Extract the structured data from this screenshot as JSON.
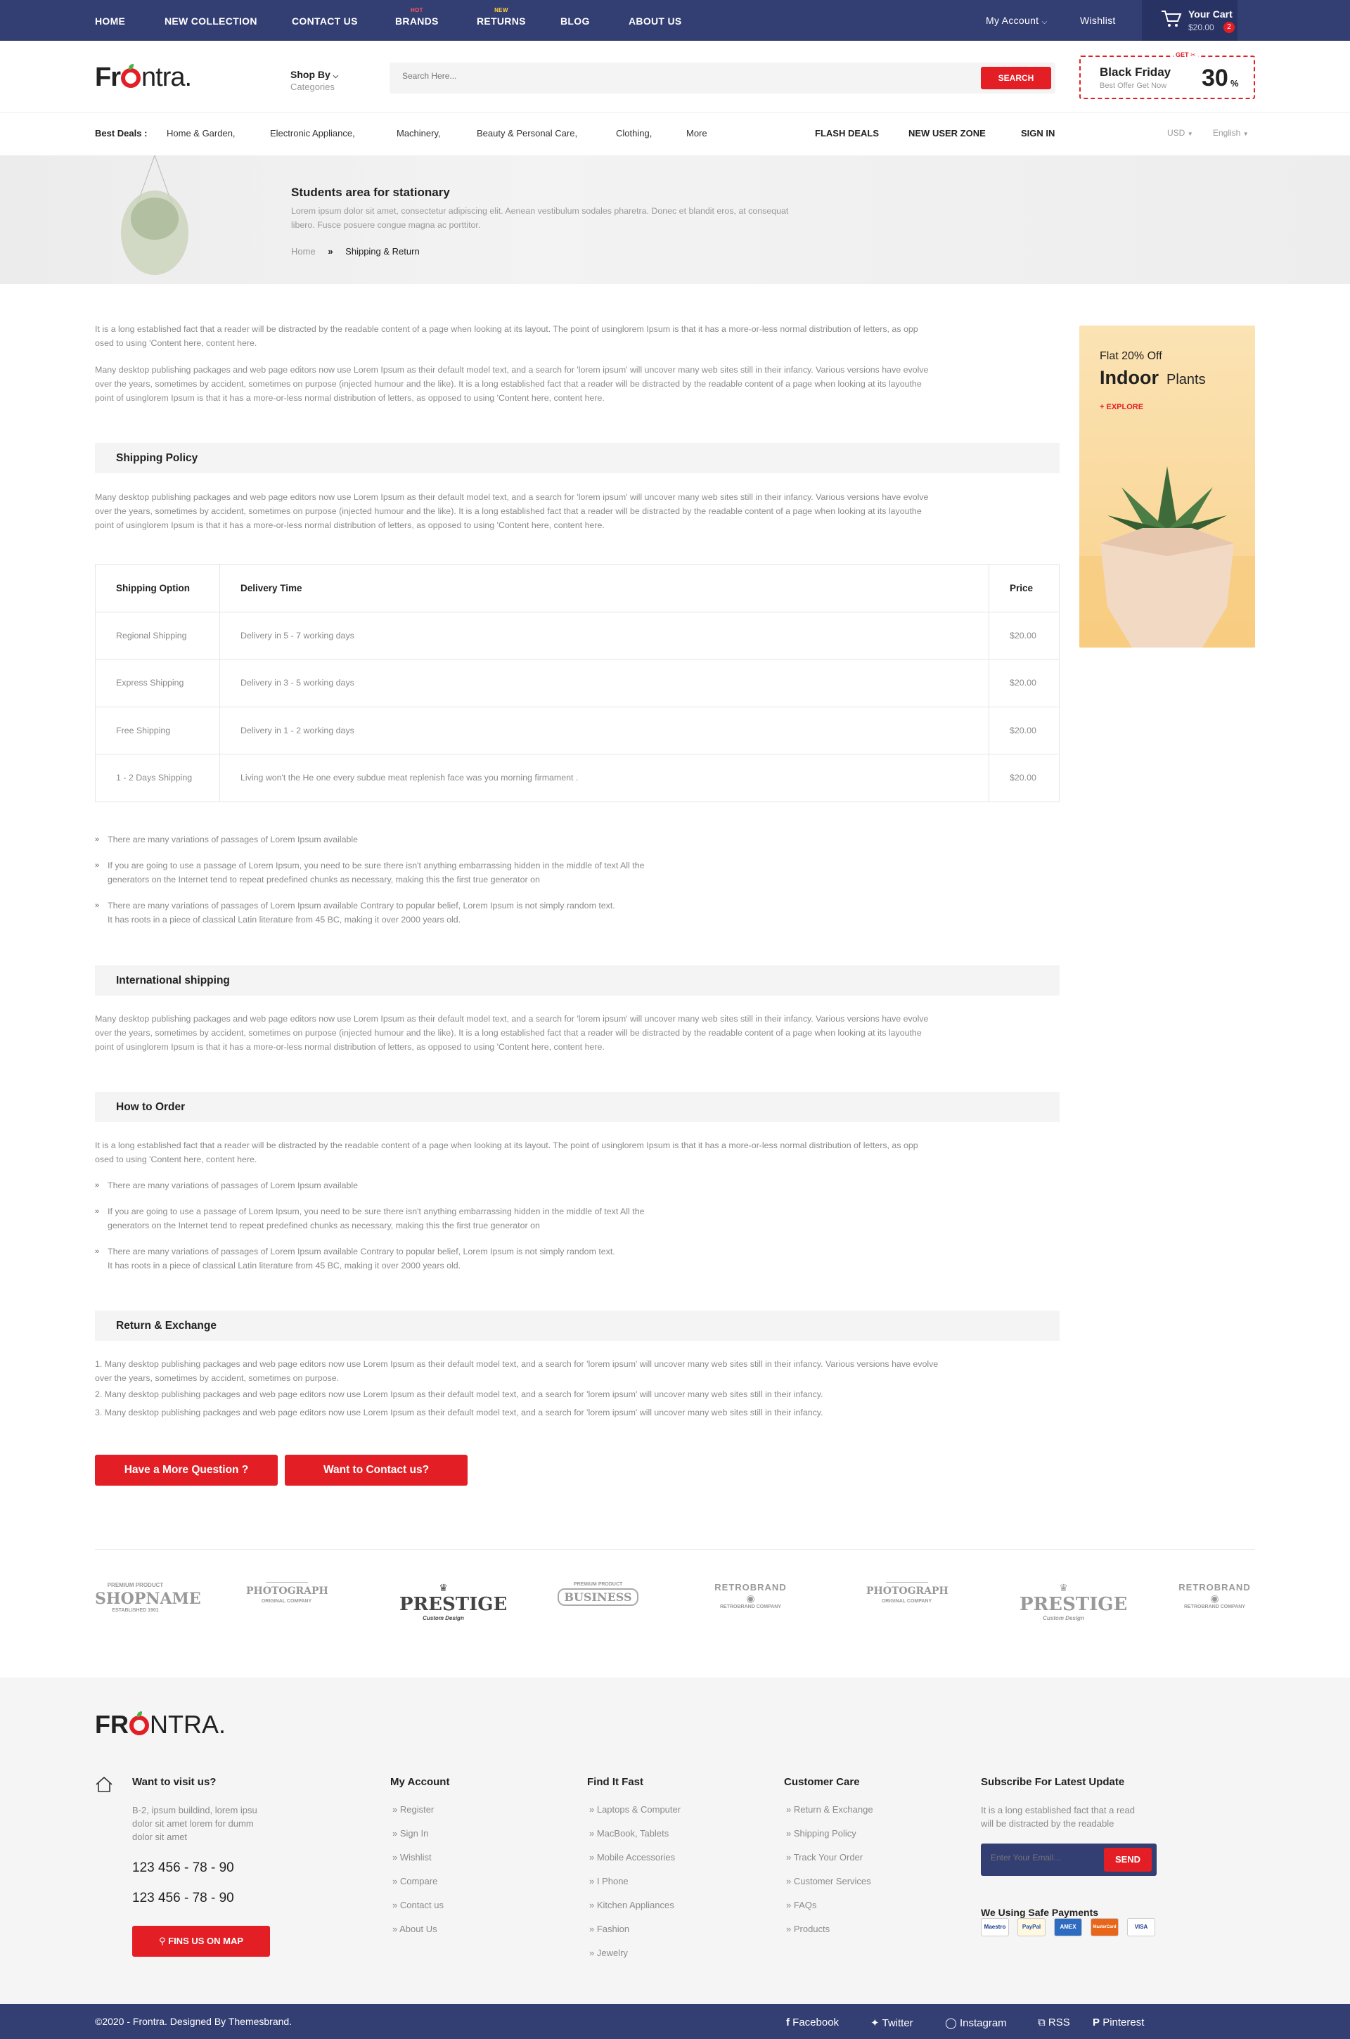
{
  "topbar": {
    "nav": [
      "HOME",
      "NEW COLLECTION",
      "CONTACT US",
      "BRANDS",
      "RETURNS",
      "BLOG",
      "ABOUT US"
    ],
    "brands_badge": "HOT",
    "returns_badge": "NEW",
    "my_account": "My Account",
    "wishlist": "Wishlist",
    "cart_title": "Your Cart",
    "cart_total": "$20.00",
    "cart_count": "2"
  },
  "header": {
    "logo_left": "Fr",
    "logo_right": "ntra.",
    "shop_by": "Shop By",
    "categories": "Categories",
    "search_placeholder": "Search Here...",
    "search_button": "SEARCH",
    "promo_get": "GET",
    "promo_title": "Black Friday",
    "promo_sub": "Best Offer Get Now",
    "promo_value": "30",
    "promo_unit": "%"
  },
  "deals": {
    "label": "Best Deals :",
    "items": [
      "Home & Garden,",
      "Electronic Appliance,",
      "Machinery,",
      "Beauty & Personal Care,",
      "Clothing,",
      "More"
    ],
    "links": [
      "FLASH DEALS",
      "NEW USER ZONE",
      "SIGN IN"
    ],
    "currency": "USD",
    "language": "English"
  },
  "banner": {
    "title": "Students area for stationary",
    "text1": "Lorem ipsum dolor sit amet, consectetur adipiscing elit. Aenean vestibulum sodales pharetra. Donec et blandit eros, at consequat",
    "text2": "libero. Fusce posuere congue magna ac porttitor.",
    "crumb_home": "Home",
    "crumb_sep": "»",
    "crumb_current": "Shipping & Return"
  },
  "intro": {
    "p1a": "It is a long established fact that a reader will be distracted by the readable content of a page when looking at its layout. The point of usinglorem Ipsum is that it has a more-or-less normal distribution of letters, as opp",
    "p1b": "osed to using 'Content here, content here.",
    "p2a": "Many desktop publishing packages and web page editors now use Lorem Ipsum as their default model text, and a search for 'lorem ipsum' will uncover many web sites still in their infancy. Various versions have evolve",
    "p2b": "over the years, sometimes by accident, sometimes on purpose (injected humour and the like). It is a long established fact that a reader will be distracted by the readable content of a page when looking at its layouthe",
    "p2c": "point of usinglorem Ipsum is that it has a more-or-less normal distribution of letters, as opposed to using 'Content here, content here."
  },
  "side_ad": {
    "line1": "Flat 20% Off",
    "big": "Indoor",
    "small": "Plants",
    "cta": "+ EXPLORE"
  },
  "shipping_policy": {
    "title": "Shipping Policy",
    "p_a": "Many desktop publishing packages and web page editors now use Lorem Ipsum as their default model text, and a search for 'lorem ipsum' will uncover many web sites still in their infancy. Various versions have evolve",
    "p_b": "over the years, sometimes by accident, sometimes on purpose (injected humour and the like). It is a long established fact that a reader will be distracted by the readable content of a page when looking at its layouthe",
    "p_c": "point of usinglorem Ipsum is that it has a more-or-less normal distribution of letters, as opposed to using 'Content here, content here."
  },
  "table": {
    "headers": [
      "Shipping Option",
      "Delivery Time",
      "Price"
    ],
    "rows": [
      [
        "Regional Shipping",
        "Delivery in 5 - 7 working days",
        "$20.00"
      ],
      [
        "Express Shipping",
        "Delivery in 3 - 5 working days",
        "$20.00"
      ],
      [
        "Free Shipping",
        "Delivery in 1 - 2 working days",
        "$20.00"
      ],
      [
        "1 - 2 Days Shipping",
        "Living won't the He one every subdue meat replenish face was you morning firmament .",
        "$20.00"
      ]
    ]
  },
  "bullets1": {
    "arrow": "»",
    "b1": "There are many variations of passages of Lorem Ipsum available",
    "b2a": " If you are going to use a passage of Lorem Ipsum, you need to be sure there isn't anything embarrassing hidden in the middle of text All the",
    "b2b": "generators on the Internet tend to repeat predefined chunks as necessary, making this the first true generator on",
    "b3a": "There are many variations of passages of Lorem Ipsum available Contrary to popular belief, Lorem Ipsum is not simply random text.",
    "b3b": "It has roots in a piece of classical Latin literature from 45 BC, making it over 2000 years old."
  },
  "international": {
    "title": "International shipping",
    "p_a": "Many desktop publishing packages and web page editors now use Lorem Ipsum as their default model text, and a search for 'lorem ipsum' will uncover many web sites still in their infancy. Various versions have evolve",
    "p_b": "over the years, sometimes by accident, sometimes on purpose (injected humour and the like). It is a long established fact that a reader will be distracted by the readable content of a page when looking at its layouthe",
    "p_c": "point of usinglorem Ipsum is that it has a more-or-less normal distribution of letters, as opposed to using 'Content here, content here."
  },
  "how_to_order": {
    "title": "How to Order",
    "p_a": "It is a long established fact that a reader will be distracted by the readable content of a page when looking at its layout. The point of usinglorem Ipsum is that it has a more-or-less normal distribution of letters, as opp",
    "p_b": "osed to using 'Content here, content here.",
    "b1": "There are many variations of passages of Lorem Ipsum available",
    "b2a": " If you are going to use a passage of Lorem Ipsum, you need to be sure there isn't anything embarrassing hidden in the middle of text All the",
    "b2b": "generators on the Internet tend to repeat predefined chunks as necessary, making this the first true generator on",
    "b3a": "There are many variations of passages of Lorem Ipsum available Contrary to popular belief, Lorem Ipsum is not simply random text.",
    "b3b": "It has roots in a piece of classical Latin literature from 45 BC, making it over 2000 years old."
  },
  "return_exchange": {
    "title": "Return & Exchange",
    "i1a": "1.  Many desktop publishing packages and web page editors now use Lorem Ipsum as their default model text, and a search for 'lorem ipsum' will uncover many web sites still in their infancy. Various versions have evolve",
    "i1b": "over the years, sometimes by accident, sometimes on purpose.",
    "i2": "2.  Many desktop publishing packages and web page editors now use Lorem Ipsum as their default model text, and a search for 'lorem ipsum' will uncover many web sites still in their infancy.",
    "i3": "3.  Many desktop publishing packages and web page editors now use Lorem Ipsum as their default model text, and a search for 'lorem ipsum' will uncover many web sites still in their infancy."
  },
  "buttons": {
    "question": "Have a More Question ?",
    "contact": "Want to Contact us?"
  },
  "brands": [
    "SHOPNAME",
    "PHOTOGRAPH",
    "PRESTIGE",
    "BUSINESS",
    "RETROBRAND",
    "PHOTOGRAPH",
    "PRESTIGE",
    "RETROBRAND"
  ],
  "footer": {
    "logo_left": "FR",
    "logo_right": "NTRA.",
    "visit_title": "Want to visit us?",
    "address1": "B-2, ipsum buildind, lorem ipsu",
    "address2": "dolor sit amet lorem for dumm",
    "address3": "dolor sit amet",
    "phone1": "123 456 - 78 - 90",
    "phone2": "123 456 - 78 - 90",
    "map_button": "FINS US ON MAP",
    "account_title": "My Account",
    "account_links": [
      "Register",
      "Sign In",
      "Wishlist",
      "Compare",
      "Contact us",
      "About Us"
    ],
    "find_title": "Find It Fast",
    "find_links": [
      "Laptops & Computer",
      "MacBook, Tablets",
      "Mobile Accessories",
      "I Phone",
      "Kitchen Appliances",
      "Fashion",
      "Jewelry"
    ],
    "care_title": "Customer Care",
    "care_links": [
      "Return & Exchange",
      "Shipping Policy",
      "Track Your Order",
      "Customer Services",
      "FAQs",
      "Products"
    ],
    "subscribe_title": "Subscribe For Latest Update",
    "subscribe_text1": "It is a long established fact that a read",
    "subscribe_text2": "will be distracted by the readable",
    "email_placeholder": "Enter Your Email...",
    "send": "SEND",
    "payments_title": "We Using Safe Payments",
    "payments": [
      "Maestro",
      "PayPal",
      "AMEX",
      "MasterCard",
      "VISA"
    ]
  },
  "bottom": {
    "copyright": "©2020 - Frontra. Designed By Themesbrand.",
    "social": [
      "Facebook",
      "Twitter",
      "Instagram",
      "RSS",
      "Pinterest"
    ]
  },
  "colors": {
    "navy": "#333e73",
    "red": "#e31e25",
    "grey_bg": "#f4f4f4"
  }
}
